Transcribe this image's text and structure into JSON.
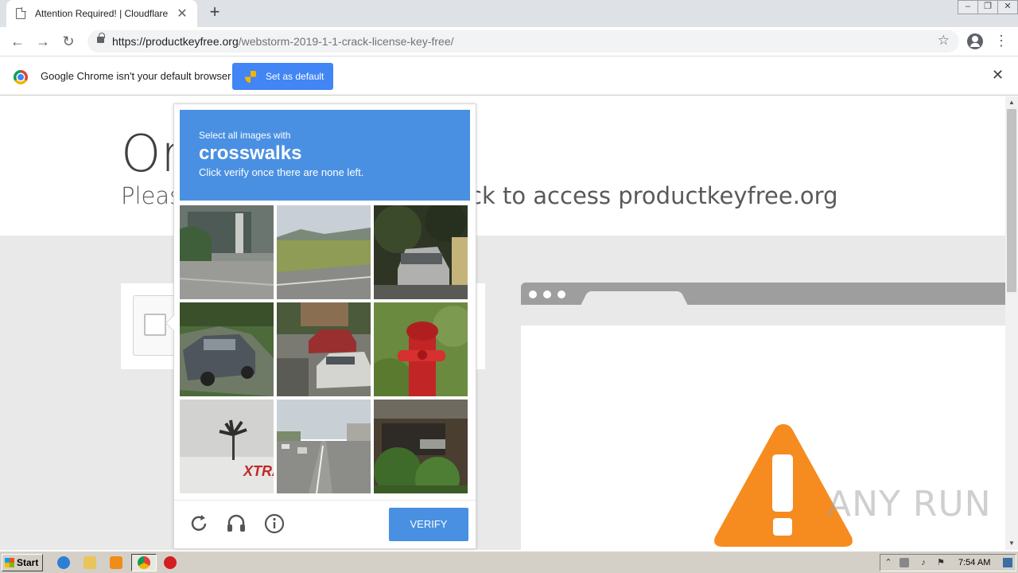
{
  "browser": {
    "tab_title": "Attention Required! | Cloudflare",
    "url_host": "https://productkeyfree.org",
    "url_path": "/webstorm-2019-1-1-crack-license-key-free/"
  },
  "infobar": {
    "message": "Google Chrome isn't your default browser",
    "button": "Set as default"
  },
  "page": {
    "heading": "On",
    "subheading_left": "Pleas",
    "subheading_right": "ck to access productkeyfree.org"
  },
  "captcha": {
    "prompt_line1": "Select all images with",
    "prompt_target": "crosswalks",
    "prompt_line3": "Click verify once there are none left.",
    "verify_label": "VERIFY",
    "tiles": [
      "building-street",
      "field-road",
      "car-dark-trees",
      "parked-car",
      "cars-parking-lot",
      "fire-hydrant",
      "palm-tree-store",
      "street-intersection",
      "building-tree"
    ]
  },
  "watermark": "ANY RUN",
  "taskbar": {
    "start_label": "Start",
    "clock": "7:54 AM"
  }
}
